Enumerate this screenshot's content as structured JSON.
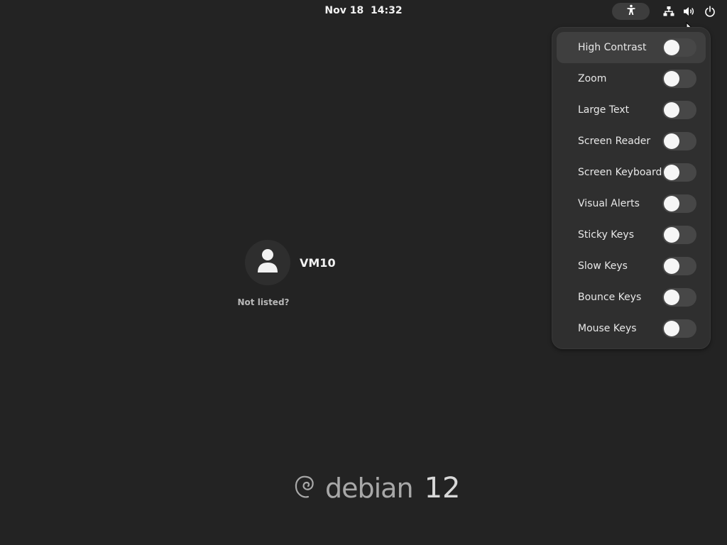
{
  "topbar": {
    "date": "Nov 18",
    "time": "14:32",
    "icons": [
      "accessibility-icon",
      "network-wired-icon",
      "volume-icon",
      "power-icon"
    ]
  },
  "accessibility_menu": {
    "items": [
      {
        "label": "High Contrast",
        "enabled": false,
        "highlighted": true
      },
      {
        "label": "Zoom",
        "enabled": false
      },
      {
        "label": "Large Text",
        "enabled": false
      },
      {
        "label": "Screen Reader",
        "enabled": false
      },
      {
        "label": "Screen Keyboard",
        "enabled": false
      },
      {
        "label": "Visual Alerts",
        "enabled": false
      },
      {
        "label": "Sticky Keys",
        "enabled": false
      },
      {
        "label": "Slow Keys",
        "enabled": false
      },
      {
        "label": "Bounce Keys",
        "enabled": false
      },
      {
        "label": "Mouse Keys",
        "enabled": false
      }
    ]
  },
  "login": {
    "user_name": "VM10",
    "not_listed": "Not listed?"
  },
  "branding": {
    "word": "debian",
    "version": "12"
  },
  "colors": {
    "background": "#232323",
    "menu_background": "#2f2f2f",
    "switch_off": "#474747",
    "text": "#e8e8e8"
  }
}
